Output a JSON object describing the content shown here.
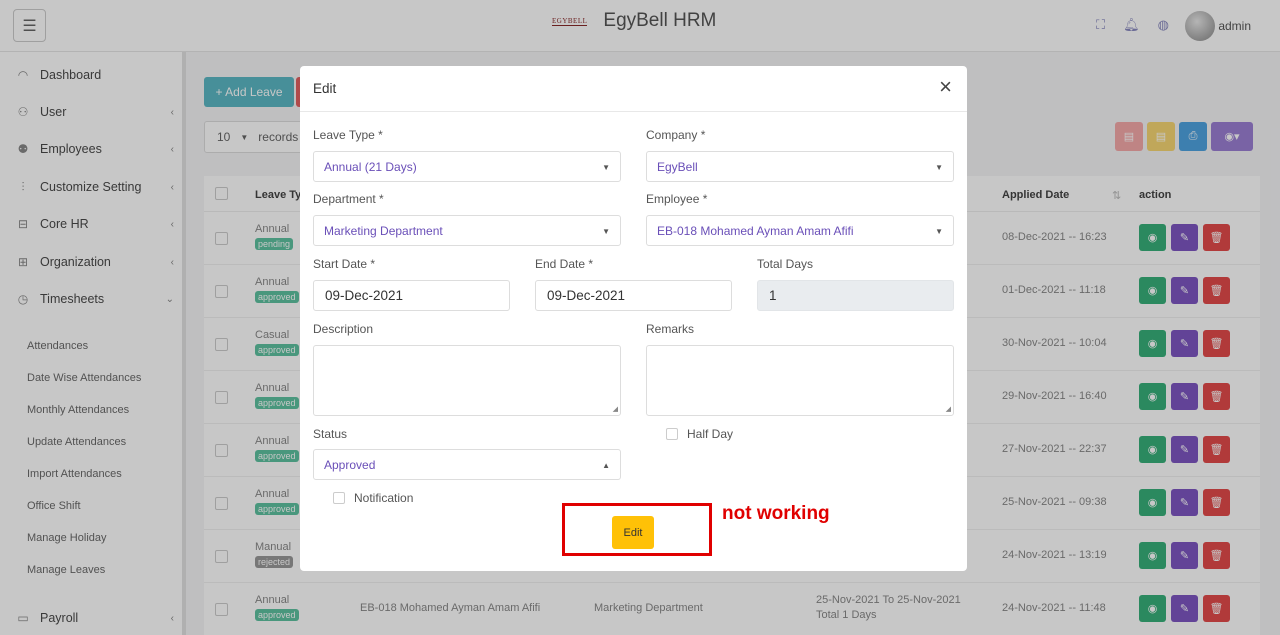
{
  "header": {
    "menu_icon": "hamburger-icon",
    "logo_text": "EGYBELL",
    "app_title": "EgyBell HRM",
    "icons": [
      "fullscreen-icon",
      "bell-icon",
      "globe-icon",
      "info-icon"
    ],
    "user": "admin"
  },
  "sidebar": {
    "items": [
      {
        "label": "Dashboard",
        "icon": "dashboard-icon",
        "chevron": ""
      },
      {
        "label": "User",
        "icon": "user-icon",
        "chevron": "‹"
      },
      {
        "label": "Employees",
        "icon": "employees-icon",
        "chevron": "‹"
      },
      {
        "label": "Customize Setting",
        "icon": "sliders-icon",
        "chevron": "‹"
      },
      {
        "label": "Core HR",
        "icon": "briefcase-icon",
        "chevron": "‹"
      },
      {
        "label": "Organization",
        "icon": "grid-icon",
        "chevron": "‹"
      },
      {
        "label": "Timesheets",
        "icon": "clock-icon",
        "chevron": "⌄"
      }
    ],
    "subitems": [
      "Attendances",
      "Date Wise Attendances",
      "Monthly Attendances",
      "Update Attendances",
      "Import Attendances",
      "Office Shift",
      "Manage Holiday",
      "Manage Leaves"
    ],
    "payroll": {
      "label": "Payroll",
      "icon": "wallet-icon",
      "chevron": "‹"
    }
  },
  "list": {
    "add_button": "+ Add Leave",
    "length_value": "10",
    "length_suffix": "records",
    "export_colors": [
      "#f5a9a9",
      "#f7d774",
      "#4fa3e0",
      "#9b7fd4"
    ],
    "columns": {
      "leave_type": "Leave Type",
      "applied_date": "Applied Date",
      "action": "action"
    },
    "rows": [
      {
        "type": "Annual",
        "status": "pending",
        "employee": "",
        "department": "",
        "period": "",
        "total": "",
        "applied": "08-Dec-2021 -- 16:23"
      },
      {
        "type": "Annual",
        "status": "approved",
        "employee": "",
        "department": "",
        "period": "",
        "total": "",
        "applied": "01-Dec-2021 -- 11:18"
      },
      {
        "type": "Casual",
        "status": "approved",
        "employee": "",
        "department": "",
        "period": "",
        "total": "",
        "applied": "30-Nov-2021 -- 10:04"
      },
      {
        "type": "Annual",
        "status": "approved",
        "employee": "",
        "department": "",
        "period": "",
        "total": "",
        "applied": "29-Nov-2021 -- 16:40"
      },
      {
        "type": "Annual",
        "status": "approved",
        "employee": "",
        "department": "",
        "period": "",
        "total": "",
        "applied": "27-Nov-2021 -- 22:37"
      },
      {
        "type": "Annual",
        "status": "approved",
        "employee": "",
        "department": "",
        "period": "",
        "total": "",
        "applied": "25-Nov-2021 -- 09:38"
      },
      {
        "type": "Manual",
        "status": "rejected",
        "employee": "",
        "department": "",
        "period": "",
        "total": "",
        "applied": "24-Nov-2021 -- 13:19"
      },
      {
        "type": "Annual",
        "status": "approved",
        "employee": "EB-018 Mohamed Ayman Amam Afifi",
        "department": "Marketing Department",
        "period": "25-Nov-2021 To 25-Nov-2021",
        "total": "Total 1 Days",
        "applied": "24-Nov-2021 -- 11:48"
      }
    ]
  },
  "modal": {
    "title": "Edit",
    "leave_type": {
      "label": "Leave Type *",
      "value": "Annual (21 Days)"
    },
    "company": {
      "label": "Company *",
      "value": "EgyBell"
    },
    "department": {
      "label": "Department *",
      "value": "Marketing Department"
    },
    "employee": {
      "label": "Employee *",
      "value": "EB-018 Mohamed Ayman Amam Afifi"
    },
    "start_date": {
      "label": "Start Date *",
      "value": "09-Dec-2021"
    },
    "end_date": {
      "label": "End Date *",
      "value": "09-Dec-2021"
    },
    "total_days": {
      "label": "Total Days",
      "value": "1"
    },
    "description": {
      "label": "Description",
      "value": ""
    },
    "remarks": {
      "label": "Remarks",
      "value": ""
    },
    "status": {
      "label": "Status",
      "value": "Approved"
    },
    "half_day": {
      "label": "Half Day",
      "checked": false
    },
    "notification": {
      "label": "Notification",
      "checked": false
    },
    "submit_label": "Edit"
  },
  "annotation": {
    "text": "not working",
    "color": "#e00000"
  }
}
